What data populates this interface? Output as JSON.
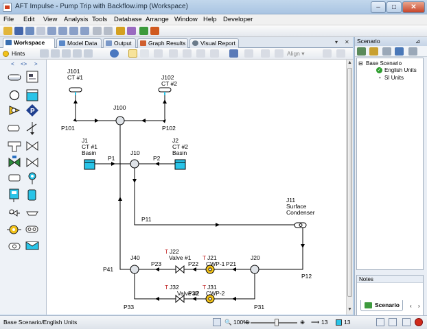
{
  "window": {
    "title": "AFT Impulse - Pump Trip with Backflow.imp (Workspace)"
  },
  "menu": [
    "File",
    "Edit",
    "View",
    "Analysis",
    "Tools",
    "Database",
    "Arrange",
    "Window",
    "Help",
    "Developer"
  ],
  "tabs": [
    {
      "label": "Workspace",
      "active": true
    },
    {
      "label": "Model Data"
    },
    {
      "label": "Output"
    },
    {
      "label": "Graph Results"
    },
    {
      "label": "Visual Report"
    }
  ],
  "toolbar2": {
    "hints_label": "Hints",
    "align_label": "Align"
  },
  "palette": {
    "scroll_left": "<",
    "scroll_mid": "<>",
    "scroll_right": ">"
  },
  "model": {
    "labels": {
      "j101": "J101",
      "j101_name": "CT #1",
      "j102": "J102",
      "j102_name": "CT #2",
      "j100": "J100",
      "p101": "P101",
      "p102": "P102",
      "j1": "J1",
      "j1_name1": "CT #1",
      "j1_name2": "Basin",
      "j2": "J2",
      "j2_name1": "CT #2",
      "j2_name2": "Basin",
      "j10": "J10",
      "p1": "P1",
      "p2": "P2",
      "p11": "P11",
      "j11": "J11",
      "j11_name1": "Surface",
      "j11_name2": "Condenser",
      "j40": "J40",
      "j20": "J20",
      "t": "T",
      "j22": "J22",
      "j22_name": "Valve #1",
      "j21": "J21",
      "j21_name": "CWP-1",
      "p23": "P23",
      "p22": "P22",
      "p21": "P21",
      "p41": "P41",
      "p12": "P12",
      "j32": "J32",
      "j32_name": "Valve #2",
      "j31": "J31",
      "j31_name": "CWP-2",
      "p32": "P32",
      "p33": "P33",
      "p31": "P31"
    }
  },
  "scenario": {
    "title": "Scenario",
    "root": "Base Scenario",
    "children": [
      "English Units",
      "SI Units"
    ],
    "notes_label": "Notes",
    "tab_label": "Scenario"
  },
  "status": {
    "text": "Base Scenario/English Units",
    "zoom": "100%",
    "pipe_count": "13",
    "junction_count": "13"
  },
  "colors": {
    "pump": "#f2c21a",
    "tank": "#29c4e8",
    "accent": "#2c5a9e"
  }
}
